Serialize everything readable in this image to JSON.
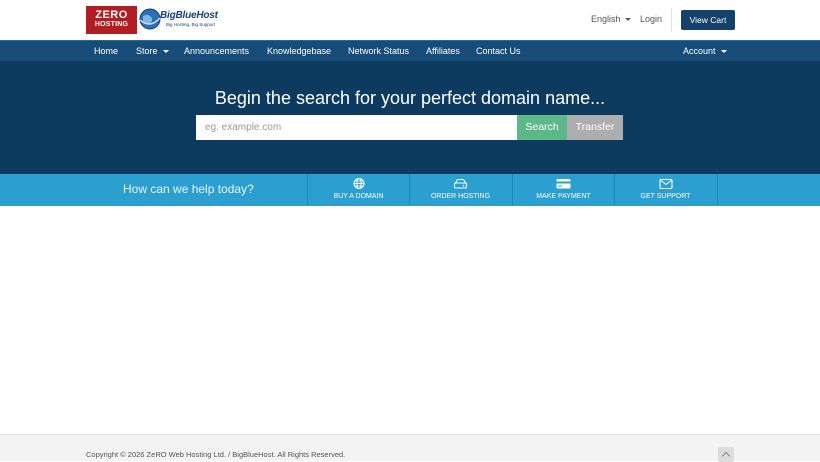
{
  "header": {
    "logo_zero_line1": "ZERO",
    "logo_zero_line2": "HOSTING",
    "logo_bbh_name": "BigBlueHost",
    "logo_bbh_tagline": "Big Hosting, Big Support",
    "language": "English",
    "login": "Login",
    "view_cart": "View Cart"
  },
  "nav": {
    "items": [
      "Home",
      "Store",
      "Announcements",
      "Knowledgebase",
      "Network Status",
      "Affiliates",
      "Contact Us"
    ],
    "account": "Account"
  },
  "hero": {
    "title": "Begin the search for your perfect domain name...",
    "search_placeholder": "eg. example.com",
    "search_button": "Search",
    "transfer_button": "Transfer"
  },
  "helpbar": {
    "title": "How can we help today?",
    "items": [
      {
        "label": "BUY A DOMAIN",
        "icon": "globe-icon"
      },
      {
        "label": "ORDER HOSTING",
        "icon": "hdd-icon"
      },
      {
        "label": "MAKE PAYMENT",
        "icon": "credit-card-icon"
      },
      {
        "label": "GET SUPPORT",
        "icon": "envelope-icon"
      }
    ]
  },
  "footer": {
    "copyright": "Copyright © 2026 ZeRO Web Hosting Ltd. / BigBlueHost. All Rights Reserved."
  },
  "colors": {
    "nav": "#184d7a",
    "hero": "#0d3a5f",
    "helpbar": "#2a9fd0",
    "search_button": "#5cb889",
    "transfer_button": "#adadad",
    "view_cart": "#14426a",
    "logo_red": "#b01e23"
  }
}
